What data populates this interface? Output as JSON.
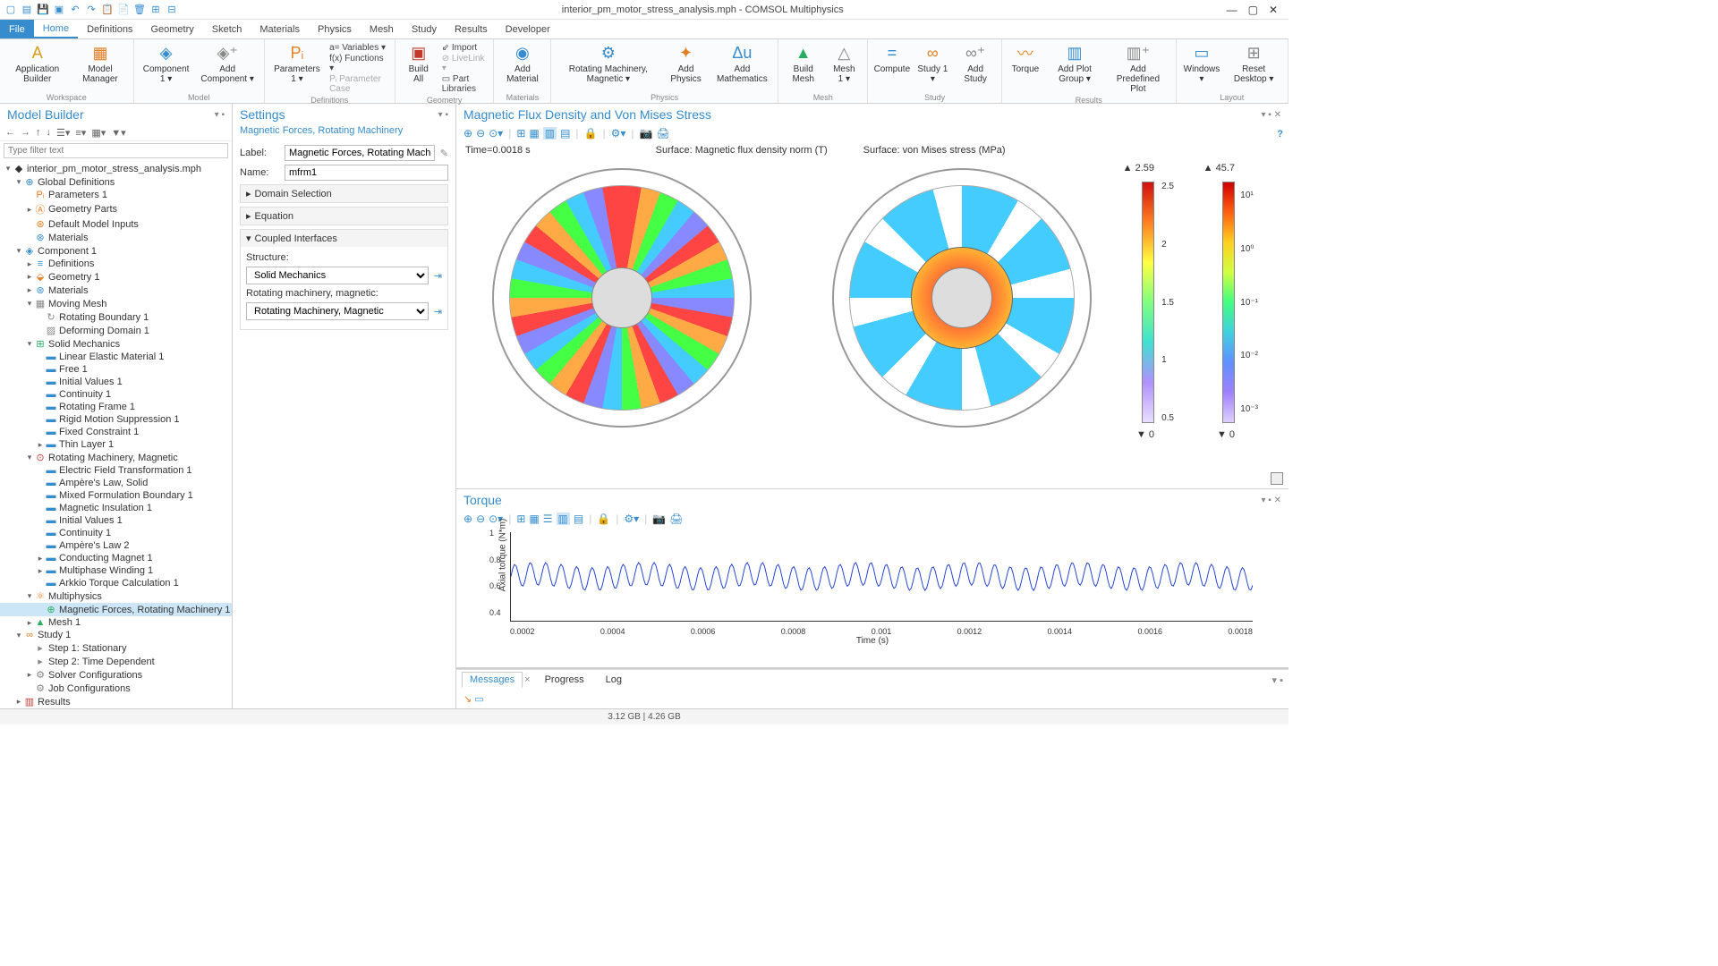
{
  "window": {
    "title": "interior_pm_motor_stress_analysis.mph - COMSOL Multiphysics",
    "min": "—",
    "max": "▢",
    "close": "✕"
  },
  "qat": [
    "▢",
    "▤",
    "▦",
    "▣",
    "⟲",
    "⟳",
    "🗐",
    "🗎",
    "📋",
    "▭",
    "⊞"
  ],
  "tabs": [
    "File",
    "Home",
    "Definitions",
    "Geometry",
    "Sketch",
    "Materials",
    "Physics",
    "Mesh",
    "Study",
    "Results",
    "Developer"
  ],
  "ribbon": {
    "workspace": {
      "label": "Workspace",
      "app_builder": "Application\nBuilder",
      "model_manager": "Model\nManager"
    },
    "model": {
      "label": "Model",
      "component": "Component\n1 ▾",
      "add_component": "Add\nComponent ▾"
    },
    "definitions": {
      "label": "Definitions",
      "parameters": "Parameters\n1 ▾",
      "variables": "a= Variables ▾",
      "functions": "f(x) Functions ▾",
      "param_case": "Pᵢ Parameter Case"
    },
    "geometry": {
      "label": "Geometry",
      "build_all": "Build\nAll",
      "import": "⇙ Import",
      "livelink": "⊘ LiveLink ▾",
      "part_libs": "▭ Part Libraries"
    },
    "materials": {
      "label": "Materials",
      "add_material": "Add\nMaterial"
    },
    "physics": {
      "label": "Physics",
      "rotating": "Rotating\nMachinery, Magnetic ▾",
      "add_physics": "Add\nPhysics",
      "add_math": "Add\nMathematics"
    },
    "mesh": {
      "label": "Mesh",
      "build_mesh": "Build\nMesh",
      "mesh1": "Mesh\n1 ▾"
    },
    "study": {
      "label": "Study",
      "compute": "Compute",
      "study1": "Study\n1 ▾",
      "add_study": "Add\nStudy"
    },
    "results": {
      "label": "Results",
      "torque": "Torque",
      "add_plot": "Add Plot\nGroup ▾",
      "add_predef": "Add\nPredefined Plot"
    },
    "layout": {
      "label": "Layout",
      "windows": "Windows\n▾",
      "reset": "Reset\nDesktop ▾"
    }
  },
  "model_builder": {
    "title": "Model Builder",
    "filter_placeholder": "Type filter text",
    "root": "interior_pm_motor_stress_analysis.mph",
    "nodes": {
      "global_defs": "Global Definitions",
      "params1": "Parameters 1",
      "geom_parts": "Geometry Parts",
      "default_inputs": "Default Model Inputs",
      "materials_g": "Materials",
      "component1": "Component 1",
      "definitions": "Definitions",
      "geometry1": "Geometry 1",
      "materials_c": "Materials",
      "moving_mesh": "Moving Mesh",
      "rotating_boundary": "Rotating Boundary 1",
      "deforming_domain": "Deforming Domain 1",
      "solid_mech": "Solid Mechanics",
      "lem1": "Linear Elastic Material 1",
      "free1": "Free 1",
      "iv1": "Initial Values 1",
      "cont1": "Continuity 1",
      "rf1": "Rotating Frame 1",
      "rms1": "Rigid Motion Suppression 1",
      "fc1": "Fixed Constraint 1",
      "thin1": "Thin Layer 1",
      "rmm": "Rotating Machinery, Magnetic",
      "eft1": "Electric Field Transformation 1",
      "al_solid": "Ampère's Law, Solid",
      "mfb1": "Mixed Formulation Boundary 1",
      "mi1": "Magnetic Insulation 1",
      "iv1b": "Initial Values 1",
      "cont1b": "Continuity 1",
      "al2": "Ampère's Law 2",
      "cm1": "Conducting Magnet 1",
      "mw1": "Multiphase Winding 1",
      "atc1": "Arkkio Torque Calculation 1",
      "multiphysics": "Multiphysics",
      "mfrm1": "Magnetic Forces, Rotating Machinery 1",
      "mesh1": "Mesh 1",
      "study1": "Study 1",
      "step1": "Step 1: Stationary",
      "step2": "Step 2: Time Dependent",
      "solver": "Solver Configurations",
      "jobs": "Job Configurations",
      "results": "Results"
    }
  },
  "settings": {
    "title": "Settings",
    "subtitle": "Magnetic Forces, Rotating Machinery",
    "label_lbl": "Label:",
    "label_val": "Magnetic Forces, Rotating Machinery 1",
    "name_lbl": "Name:",
    "name_val": "mfrm1",
    "sec_domain": "Domain Selection",
    "sec_equation": "Equation",
    "sec_coupled": "Coupled Interfaces",
    "structure_lbl": "Structure:",
    "structure_val": "Solid Mechanics",
    "rmm_lbl": "Rotating machinery, magnetic:",
    "rmm_val": "Rotating Machinery, Magnetic"
  },
  "graphics": {
    "title1": "Magnetic Flux Density and Von Mises Stress",
    "time": "Time=0.0018 s",
    "surf1": "Surface: Magnetic flux density norm (T)",
    "surf2": "Surface: von Mises stress (MPa)",
    "max1": "▲ 2.59",
    "min1": "▼ 0",
    "max2": "▲ 45.7",
    "min2": "▼ 0",
    "ticks1": [
      "2.5",
      "2",
      "1.5",
      "1",
      "0.5"
    ],
    "ticks2": [
      "10¹",
      "10⁰",
      "10⁻¹",
      "10⁻²",
      "10⁻³"
    ],
    "title2": "Torque",
    "ylabel": "Axial torque (N*m)",
    "xlabel": "Time (s)",
    "yticks": [
      "1",
      "0.8",
      "0.6",
      "0.4"
    ],
    "xticks": [
      "0.0002",
      "0.0004",
      "0.0006",
      "0.0008",
      "0.001",
      "0.0012",
      "0.0014",
      "0.0016",
      "0.0018"
    ]
  },
  "chart_data": {
    "type": "line",
    "title": "Torque",
    "xlabel": "Time (s)",
    "ylabel": "Axial torque (N*m)",
    "ylim": [
      0.3,
      1.0
    ],
    "xlim": [
      0,
      0.0018
    ],
    "note": "Oscillating torque ripple, ~48 cycles over 0.0018s, mean ≈0.63 N·m, amplitude ≈0.09 N·m",
    "series": [
      {
        "name": "Axial torque",
        "mean": 0.63,
        "amplitude": 0.09,
        "frequency_hz": 26667
      }
    ]
  },
  "bottom_tabs": {
    "messages": "Messages",
    "progress": "Progress",
    "log": "Log"
  },
  "status": "3.12 GB | 4.26 GB"
}
